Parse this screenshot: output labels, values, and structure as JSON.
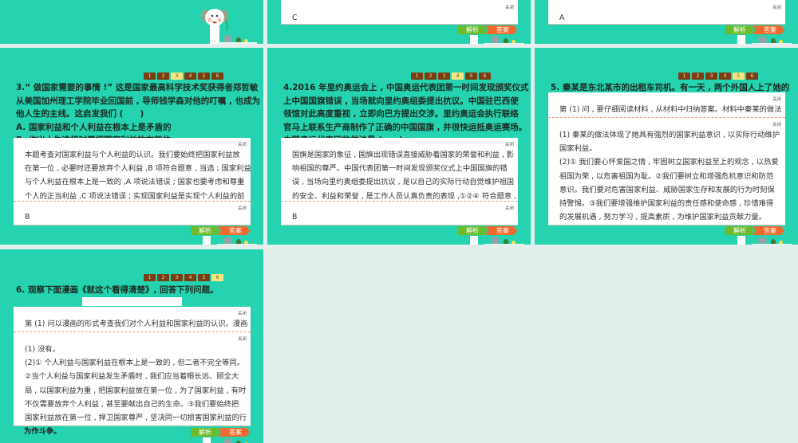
{
  "labels": {
    "close": "关闭",
    "analysis": "解析",
    "answer": "答案"
  },
  "nav": [
    "1",
    "2",
    "3",
    "4",
    "5",
    "6"
  ],
  "slides": [
    {
      "kind": "mascot"
    },
    {
      "kind": "tail",
      "answer": "C"
    },
    {
      "kind": "tail",
      "answer": "A"
    },
    {
      "kind": "full",
      "active": 2,
      "question": [
        "3.“ 做国家需要的事情 !” 这是国家最高科学技术奖获得者郑哲敏",
        "从美国加州理工学院毕业回国前 , 导师钱学森对他的叮嘱 , 也成为",
        "他人生的主线。这启发我们 (　　)",
        "A. 国家利益和个人利益在根本上是矛盾的",
        "B. 作出人生选择时要把国家利益放在首位"
      ],
      "explanation": [
        "本题考查对国家利益与个人利益的认识。我们要始终把国家利益放",
        "在第一位 , 必要时还要放弃个人利益 ,B 项符合题意 , 当选 ; 国家利益",
        "与个人利益在根本上是一致的 ,A 项说法错误 ; 国家也要考虑和尊重",
        "个人的正当利益 ,C 项说法错误 ; 实现国家利益是实现个人利益的前"
      ],
      "answer": "B"
    },
    {
      "kind": "full",
      "active": 3,
      "question": [
        "4.2016 年里约奥运会上 , 中国奥运代表团第一时间发现颁奖仪式",
        "上中国国旗错误 , 当场就向里约奥组委提出抗议。中国驻巴西使",
        "领馆对此高度重视 , 立即向巴方提出交涉。里约奥运会执行联络",
        "官马上联系生产商制作了正确的中国国旗 , 并很快运抵奥运赛场。",
        "中国奥运代表团的做法是 (　　)"
      ],
      "explanation": [
        "国旗是国家的象征 , 国旗出现错误直接威胁着国家的荣誉和利益 , 影",
        "响祖国的尊严。中国代表团第一时间发现颁奖仪式上中国国旗的错",
        "误 , 当场向里约奥组委提出抗议 , 是以自己的实际行动自觉维护祖国",
        "的安全、利益和荣誉 , 是工作人员认真负责的表现 ,①②④ 符合题意 ,"
      ],
      "answer": "B"
    },
    {
      "kind": "q5",
      "active": 4,
      "question": [
        "5. 秦某是东北某市的出租车司机。有一天 , 两个外国人上了她的"
      ],
      "explanation": [
        "第 (1) 问 , 要仔细阅读材料 , 从材料中归纳答案。材料中秦某的做法"
      ],
      "answer_lines": [
        "(1) 秦某的做法体现了她具有强烈的国家利益意识 , 以实际行动维护",
        "国家利益。",
        "(2)① 我们要心怀爱国之情 , 牢固树立国家利益至上的观念 , 以热爱",
        "祖国为荣 , 以危害祖国为耻。②我们要树立和增强危机意识和防范",
        "意识。我们要对危害国家利益、威胁国家生存和发展的行为时刻保",
        "持警惕。③我们要增强维护国家利益的责任感和使命感 , 珍惜难得",
        "的发展机遇 , 努力学习 , 提高素质 , 为维护国家利益贡献力量。"
      ]
    },
    {
      "kind": "q6",
      "active": 5,
      "question": [
        "6. 观察下面漫画《就这个看得清楚》, 回答下列问题。"
      ],
      "explanation": [
        "第 (1) 问以漫画的形式考查我们对个人利益和国家利益的认识。漫画"
      ],
      "answer_lines": [
        "(1) 没有。",
        "(2)① 个人利益与国家利益在根本上是一致的 , 但二者不完全等同。",
        "②当个人利益与国家利益发生矛盾时 , 我们应当着眼长远、顾全大",
        "局 , 以国家利益为重 , 把国家利益放在第一位 , 为了国家利益 , 有时",
        "不仅需要放弃个人利益 , 甚至要献出自己的生命。③我们要始终把",
        "国家利益放在第一位 , 捍卫国家尊严 , 坚决同一切损害国家利益的行"
      ],
      "after": "为作斗争。"
    }
  ]
}
